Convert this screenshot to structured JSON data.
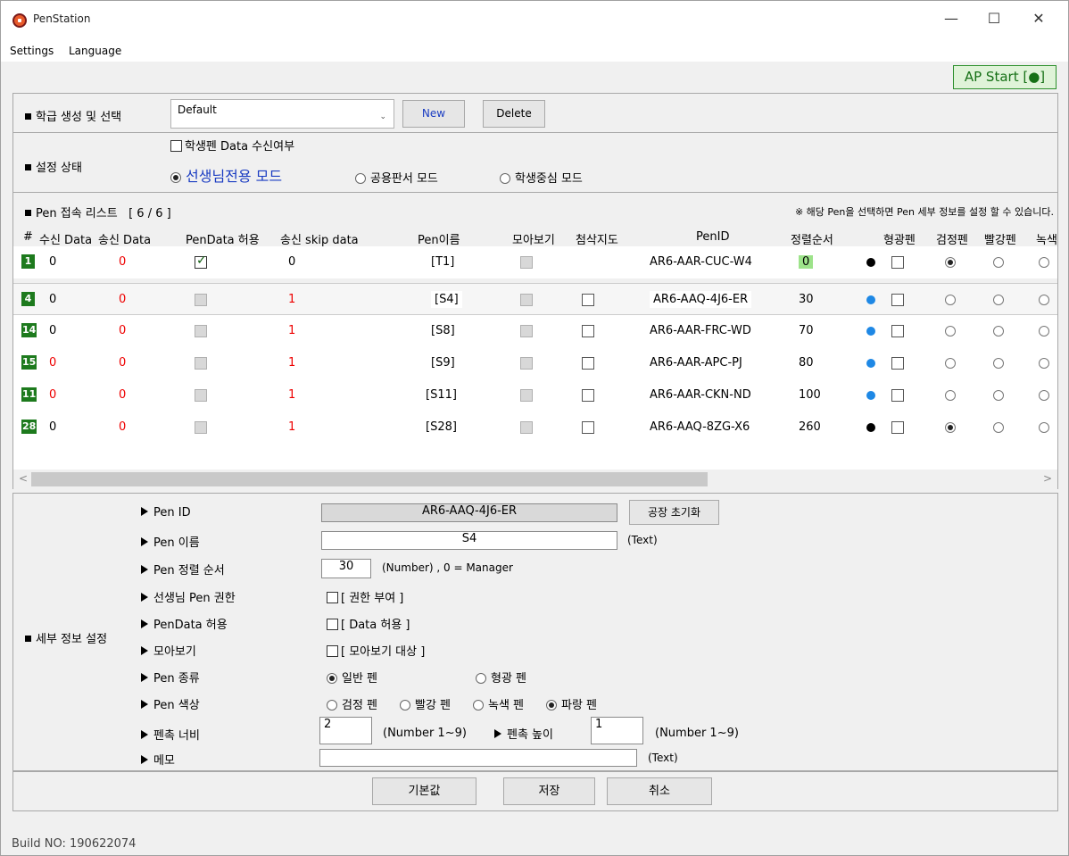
{
  "window": {
    "title": "PenStation"
  },
  "menu": {
    "settings": "Settings",
    "language": "Language"
  },
  "ap_button": "AP Start [●]",
  "class_panel": {
    "title": "학급 생성 및 선택",
    "selected": "Default",
    "new_label": "New",
    "delete_label": "Delete"
  },
  "setting_panel": {
    "title": "설정 상태",
    "student_pen_receive": "학생펜 Data 수신여부",
    "student_pen_receive_checked": false,
    "modes": [
      {
        "label": "선생님전용 모드",
        "selected": true
      },
      {
        "label": "공용판서 모드",
        "selected": false
      },
      {
        "label": "학생중심 모드",
        "selected": false
      }
    ]
  },
  "pen_list": {
    "title": "Pen 접속 리스트",
    "count": "[ 6 / 6 ]",
    "note": "※ 해당 Pen을 선택하면 Pen 세부 정보를 설정 할 수 있습니다.",
    "columns": [
      "#",
      "수신 Data",
      "송신 Data",
      "PenData 허용",
      "송신 skip data",
      "Pen이름",
      "모아보기",
      "첨삭지도",
      "PenID",
      "정렬순서",
      "",
      "형광펜",
      "검정펜",
      "빨강펜",
      "녹색"
    ],
    "rows": [
      {
        "num": "1",
        "recv": "0",
        "send": "0",
        "pendata": true,
        "skip": "0",
        "name": "[T1]",
        "gather": false,
        "correct": null,
        "penid": "AR6-AAR-CUC-W4",
        "order": "0",
        "dot": "#000000",
        "highlight": false,
        "color": "black",
        "selected": false
      },
      {
        "num": "4",
        "recv": "0",
        "send": "0",
        "pendata": false,
        "skip": "1",
        "name": "[S4]",
        "gather": false,
        "correct": false,
        "penid": "AR6-AAQ-4J6-ER",
        "order": "30",
        "dot": "#1e88e5",
        "highlight": false,
        "color": "blue",
        "selected": true
      },
      {
        "num": "14",
        "recv": "0",
        "send": "0",
        "pendata": false,
        "skip": "1",
        "name": "[S8]",
        "gather": false,
        "correct": false,
        "penid": "AR6-AAR-FRC-WD",
        "order": "70",
        "dot": "#1e88e5",
        "highlight": false,
        "color": "blue",
        "selected": false
      },
      {
        "num": "15",
        "recv": "0",
        "send": "0",
        "pendata": false,
        "skip": "1",
        "name": "[S9]",
        "gather": false,
        "correct": false,
        "penid": "AR6-AAR-APC-PJ",
        "order": "80",
        "dot": "#1e88e5",
        "highlight": false,
        "color": "blue",
        "selected": false
      },
      {
        "num": "11",
        "recv": "0",
        "send": "0",
        "pendata": false,
        "skip": "1",
        "name": "[S11]",
        "gather": false,
        "correct": false,
        "penid": "AR6-AAR-CKN-ND",
        "order": "100",
        "dot": "#1e88e5",
        "highlight": false,
        "color": "blue",
        "selected": false
      },
      {
        "num": "28",
        "recv": "0",
        "send": "0",
        "pendata": false,
        "skip": "1",
        "name": "[S28]",
        "gather": false,
        "correct": false,
        "penid": "AR6-AAQ-8ZG-X6",
        "order": "260",
        "dot": "#000000",
        "highlight": false,
        "color": "black",
        "selected": false
      }
    ]
  },
  "detail": {
    "title": "세부 정보 설정",
    "pen_id_label": "Pen ID",
    "pen_id": "AR6-AAQ-4J6-ER",
    "factory_reset": "공장 초기화",
    "name_label": "Pen 이름",
    "name": "S4",
    "name_hint": "(Text)",
    "order_label": "Pen 정렬 순서",
    "order": "30",
    "order_hint": "(Number) , 0 = Manager",
    "teacher_label": "선생님 Pen 권한",
    "teacher_chk": "[ 권한 부여 ]",
    "pendata_label": "PenData 허용",
    "pendata_chk": "[ Data 허용 ]",
    "gather_label": "모아보기",
    "gather_chk": "[ 모아보기 대상 ]",
    "type_label": "Pen 종류",
    "type_normal": "일반 펜",
    "type_highlight": "형광 펜",
    "color_label": "Pen 색상",
    "colors": [
      {
        "label": "검정 펜",
        "selected": false
      },
      {
        "label": "빨강 펜",
        "selected": false
      },
      {
        "label": "녹색 펜",
        "selected": false
      },
      {
        "label": "파랑 펜",
        "selected": true
      }
    ],
    "width_label": "펜촉 너비",
    "width": "2",
    "width_hint": "(Number 1~9)",
    "height_label": "펜촉 높이",
    "height": "1",
    "height_hint": "(Number 1~9)",
    "memo_label": "메모",
    "memo": "",
    "memo_hint": "(Text)"
  },
  "buttons": {
    "default": "기본값",
    "save": "저장",
    "cancel": "취소"
  },
  "build": "Build NO: 190622074"
}
